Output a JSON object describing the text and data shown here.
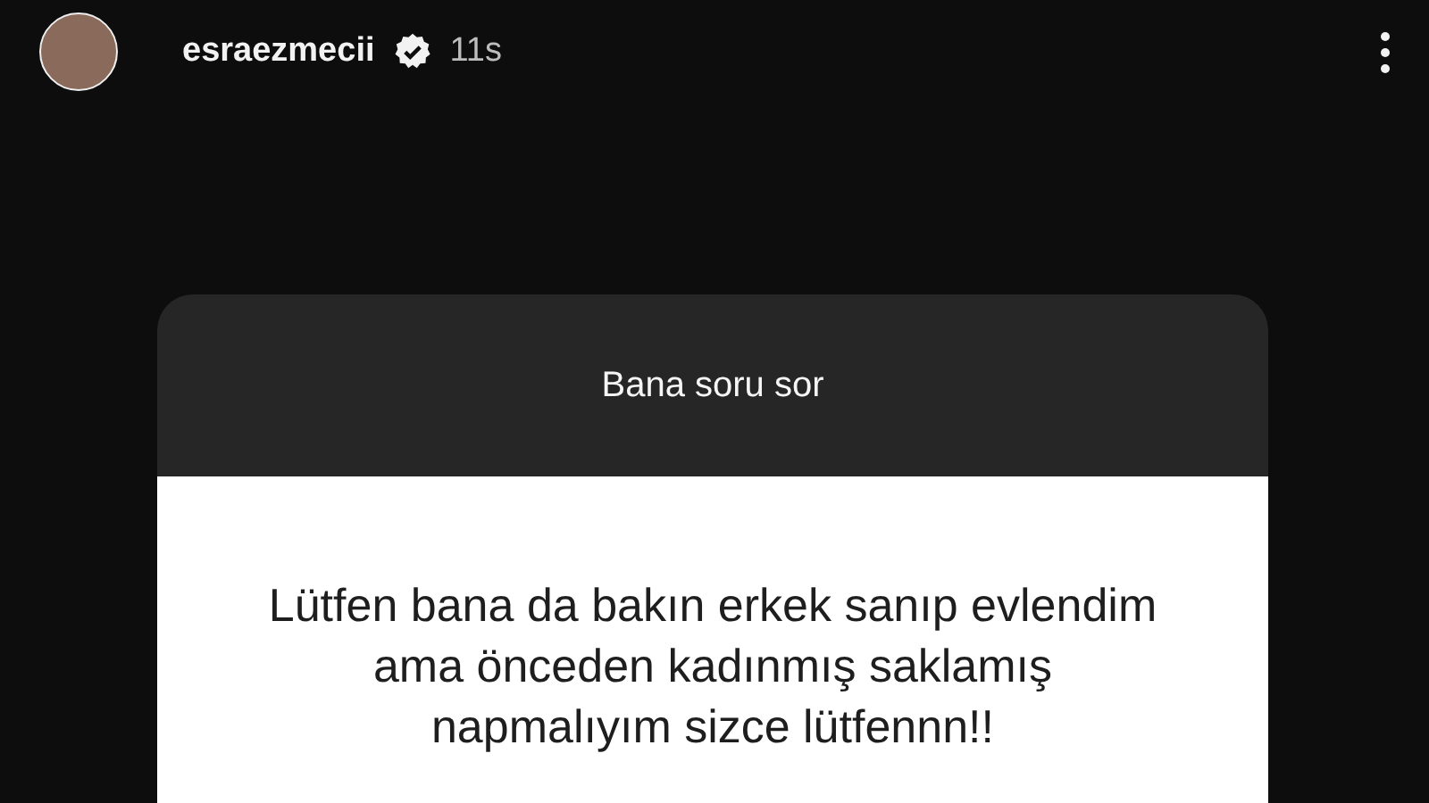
{
  "story_header": {
    "username": "esraezmecii",
    "verified": true,
    "time": "11s"
  },
  "question_card": {
    "title": "Bana soru sor",
    "answer": "Lütfen bana da bakın erkek sanıp evlendim ama önceden kadınmış saklamış napmalıyım sizce lütfennn!!"
  }
}
